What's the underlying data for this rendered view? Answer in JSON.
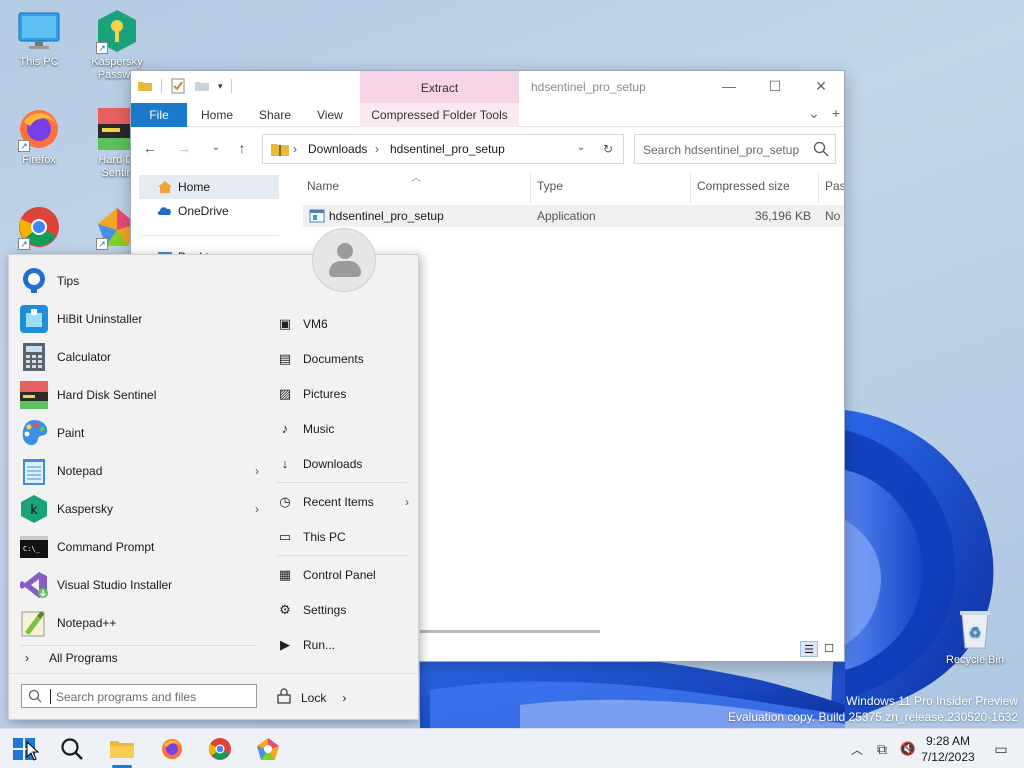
{
  "desktop": {
    "icons": [
      {
        "label": "This PC"
      },
      {
        "label": "Kaspersky Passwo"
      },
      {
        "label": "Firefox"
      },
      {
        "label": "Hard Di Sentin"
      },
      {
        "label": ""
      },
      {
        "label": ""
      },
      {
        "label": "Recycle Bin"
      }
    ],
    "watermark_line1": "Windows 11 Pro Insider Preview",
    "watermark_line2": "Evaluation copy. Build 25375.zn_release.230520-1632"
  },
  "explorer": {
    "title": "hdsentinel_pro_setup",
    "context_tab_group": "Extract",
    "ribbon_tabs": [
      "File",
      "Home",
      "Share",
      "View",
      "Compressed Folder Tools"
    ],
    "address": {
      "crumbs": [
        "Downloads",
        "hdsentinel_pro_setup"
      ]
    },
    "search_placeholder": "Search hdsentinel_pro_setup",
    "nav_items": [
      {
        "label": "Home"
      },
      {
        "label": "OneDrive"
      },
      {
        "label": "Deskt"
      }
    ],
    "columns": [
      "Name",
      "Type",
      "Compressed size",
      "Pass"
    ],
    "files": [
      {
        "name": "hdsentinel_pro_setup",
        "type": "Application",
        "size": "36,196 KB",
        "pass": "No"
      }
    ]
  },
  "start_menu": {
    "programs": [
      {
        "label": "Tips",
        "has_submenu": false
      },
      {
        "label": "HiBit Uninstaller",
        "has_submenu": false
      },
      {
        "label": "Calculator",
        "has_submenu": false
      },
      {
        "label": "Hard Disk Sentinel",
        "has_submenu": false
      },
      {
        "label": "Paint",
        "has_submenu": false
      },
      {
        "label": "Notepad",
        "has_submenu": true
      },
      {
        "label": "Kaspersky",
        "has_submenu": true
      },
      {
        "label": "Command Prompt",
        "has_submenu": false
      },
      {
        "label": "Visual Studio Installer",
        "has_submenu": false
      },
      {
        "label": "Notepad++",
        "has_submenu": false
      }
    ],
    "all_programs": "All Programs",
    "places": [
      {
        "label": "VM6",
        "icon": "user-folder-icon"
      },
      {
        "label": "Documents",
        "icon": "document-icon"
      },
      {
        "label": "Pictures",
        "icon": "picture-icon"
      },
      {
        "label": "Music",
        "icon": "music-note-icon"
      },
      {
        "label": "Downloads",
        "icon": "download-arrow-icon"
      },
      {
        "label": "Recent Items",
        "icon": "clock-icon"
      },
      {
        "label": "This PC",
        "icon": "computer-icon"
      },
      {
        "label": "Control Panel",
        "icon": "control-panel-icon"
      },
      {
        "label": "Settings",
        "icon": "gear-icon"
      },
      {
        "label": "Run...",
        "icon": "run-icon"
      }
    ],
    "search_placeholder": "Search programs and files",
    "lock_label": "Lock"
  },
  "taskbar": {
    "time": "9:28 AM",
    "date": "7/12/2023"
  },
  "colors": {
    "accent": "#1979ca",
    "context_tab": "#f6d3e5",
    "wallpaper": "#b4cbe4",
    "bloom": "#1546c9"
  }
}
